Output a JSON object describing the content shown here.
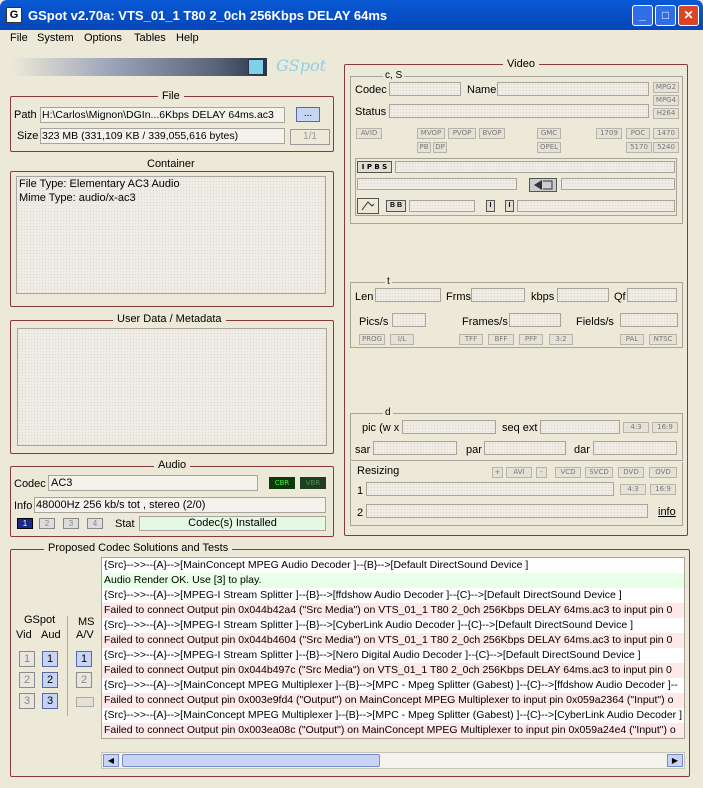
{
  "window": {
    "title": "GSpot v2.70a: VTS_01_1 T80 2_0ch 256Kbps DELAY 64ms",
    "icon": "G",
    "min_glyph": "_",
    "max_glyph": "□",
    "close_glyph": "✕"
  },
  "menu": [
    "File",
    "System",
    "Options",
    "Tables",
    "Help"
  ],
  "logo": "GSpot",
  "file": {
    "title": "File",
    "path_label": "Path",
    "path_value": "H:\\Carlos\\Mignon\\DGIn...6Kbps DELAY 64ms.ac3",
    "browse_label": "...",
    "size_label": "Size",
    "size_value": "323 MB (331,109 KB / 339,055,616 bytes)",
    "page_label": "1/1"
  },
  "container": {
    "title": "Container",
    "line1": "File Type: Elementary AC3 Audio",
    "line2": "Mime Type: audio/x-ac3"
  },
  "userdata": {
    "title": "User Data / Metadata"
  },
  "audio": {
    "title": "Audio",
    "codec_label": "Codec",
    "codec_value": "AC3",
    "cbr": "CBR",
    "vbr": "VBR",
    "info_label": "Info",
    "info_value": "48000Hz  256 kb/s tot , stereo (2/0)",
    "stat_label": "Stat",
    "stat_value": "Codec(s) Installed",
    "stream_buttons": [
      "1",
      "2",
      "3",
      "4"
    ]
  },
  "video": {
    "title": "Video",
    "cs_label": "c, S",
    "codec_label": "Codec",
    "name_label": "Name",
    "status_label": "Status",
    "mpeg_btns": [
      "MPG2",
      "MPG4",
      "H264"
    ],
    "row_btns_a": [
      "AVID"
    ],
    "row_btns_b": [
      "MVOP",
      "PVOP",
      "BVOP"
    ],
    "row_btns_c": [
      "PB",
      "DP"
    ],
    "row_btns_d": [
      "GMC",
      "OPEL"
    ],
    "row_btns_e": [
      "1709",
      "POC",
      "1470",
      "5170",
      "5240"
    ],
    "ipbs": "I P B S",
    "bb": "B B",
    "i1": "I",
    "i2": "I"
  },
  "timing": {
    "title": "t",
    "len_label": "Len",
    "frms_label": "Frms",
    "kbps_label": "kbps",
    "qf_label": "Qf",
    "pics_label": "Pics/s",
    "frames_label": "Frames/s",
    "fields_label": "Fields/s",
    "btns_left": [
      "PROG",
      "I/L"
    ],
    "btns_mid": [
      "TFF",
      "BFF",
      "PFF",
      "3:2"
    ],
    "btns_right": [
      "PAL",
      "NTSC"
    ]
  },
  "dims": {
    "title": "d",
    "pic_label": "pic (w x",
    "seqext_label": "seq ext",
    "ar1": "4:3",
    "ar2": "16:9",
    "sar_label": "sar",
    "par_label": "par",
    "dar_label": "dar",
    "resizing_label": "Resizing",
    "resize_btns": [
      "+",
      "AVI",
      "-",
      "VCD",
      "SVCD",
      "DVD",
      "OVD"
    ],
    "row1_label": "1",
    "row2_label": "2",
    "ar3": "4:3",
    "ar4": "16:9",
    "info_link": "info"
  },
  "codec": {
    "title": "Proposed Codec Solutions and Tests",
    "gspot_label": "GSpot",
    "vid_label": "Vid",
    "aud_label": "Aud",
    "ms_label": "MS",
    "av_label": "A/V",
    "log": [
      {
        "kind": "src",
        "text": "{Src}-->>--{A}-->[MainConcept MPEG Audio Decoder ]--{B}-->[Default DirectSound Device ]"
      },
      {
        "kind": "ok",
        "text": "Audio Render OK. Use [3] to play."
      },
      {
        "kind": "src",
        "text": "{Src}-->>--{A}-->[MPEG-I Stream Splitter ]--{B}-->[ffdshow Audio Decoder ]--{C}-->[Default DirectSound Device ]"
      },
      {
        "kind": "fail",
        "text": "Failed to connect Output pin 0x044b42a4 (\"Src Media\") on VTS_01_1 T80 2_0ch 256Kbps DELAY 64ms.ac3 to input pin 0"
      },
      {
        "kind": "src",
        "text": "{Src}-->>--{A}-->[MPEG-I Stream Splitter ]--{B}-->[CyberLink Audio Decoder ]--{C}-->[Default DirectSound Device ]"
      },
      {
        "kind": "fail",
        "text": "Failed to connect Output pin 0x044b4604 (\"Src Media\") on VTS_01_1 T80 2_0ch 256Kbps DELAY 64ms.ac3 to input pin 0"
      },
      {
        "kind": "src",
        "text": "{Src}-->>--{A}-->[MPEG-I Stream Splitter ]--{B}-->[Nero Digital Audio Decoder ]--{C}-->[Default DirectSound Device ]"
      },
      {
        "kind": "fail",
        "text": "Failed to connect Output pin 0x044b497c (\"Src Media\") on VTS_01_1 T80 2_0ch 256Kbps DELAY 64ms.ac3 to input pin 0"
      },
      {
        "kind": "src",
        "text": "{Src}-->>--{A}-->[MainConcept MPEG Multiplexer ]--{B}-->[MPC - Mpeg Splitter (Gabest) ]--{C}-->[ffdshow Audio Decoder ]--"
      },
      {
        "kind": "fail",
        "text": "Failed to connect Output pin 0x003e9fd4 (\"Output\") on MainConcept MPEG Multiplexer to input pin 0x059a2364 (\"Input\") o"
      },
      {
        "kind": "src",
        "text": "{Src}-->>--{A}-->[MainConcept MPEG Multiplexer ]--{B}-->[MPC - Mpeg Splitter (Gabest) ]--{C}-->[CyberLink Audio Decoder ]"
      },
      {
        "kind": "fail",
        "text": "Failed to connect Output pin 0x003ea08c (\"Output\") on MainConcept MPEG Multiplexer to input pin 0x059a24e4 (\"Input\") o"
      }
    ],
    "scroll_left": "◀",
    "scroll_right": "▶"
  }
}
